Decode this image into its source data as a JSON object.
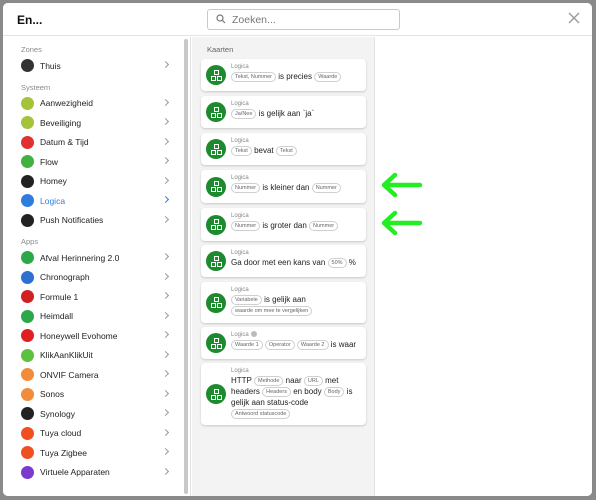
{
  "window": {
    "title": "En..."
  },
  "search": {
    "placeholder": "Zoeken..."
  },
  "sidebar": {
    "sections": [
      {
        "title": "Zones",
        "items": [
          {
            "label": "Thuis",
            "icon": "home-icon",
            "color": "#333333"
          }
        ]
      },
      {
        "title": "Systeem",
        "items": [
          {
            "label": "Aanwezigheid",
            "icon": "presence-icon",
            "color": "#a4c23a"
          },
          {
            "label": "Beveiliging",
            "icon": "security-icon",
            "color": "#a4c23a"
          },
          {
            "label": "Datum & Tijd",
            "icon": "calendar-icon",
            "color": "#e03030"
          },
          {
            "label": "Flow",
            "icon": "flow-icon",
            "color": "#40b040"
          },
          {
            "label": "Homey",
            "icon": "homey-icon",
            "color": "#222222"
          },
          {
            "label": "Logica",
            "icon": "logic-icon",
            "color": "#2f7ce0"
          },
          {
            "label": "Push Notificaties",
            "icon": "phone-icon",
            "color": "#222222"
          }
        ]
      },
      {
        "title": "Apps",
        "items": [
          {
            "label": "Afval Herinnering 2.0",
            "icon": "trash-icon",
            "color": "#2aa84a"
          },
          {
            "label": "Chronograph",
            "icon": "stopwatch-icon",
            "color": "#2f6fcf"
          },
          {
            "label": "Formule 1",
            "icon": "f1-icon",
            "color": "#d02020"
          },
          {
            "label": "Heimdall",
            "icon": "shield-icon",
            "color": "#2aa84a"
          },
          {
            "label": "Honeywell Evohome",
            "icon": "honeywell-icon",
            "color": "#e02020"
          },
          {
            "label": "KlikAanKlikUit",
            "icon": "kaku-icon",
            "color": "#5cc040"
          },
          {
            "label": "ONVIF Camera",
            "icon": "camera-icon",
            "color": "#f08c3a"
          },
          {
            "label": "Sonos",
            "icon": "sonos-icon",
            "color": "#f08c3a"
          },
          {
            "label": "Synology",
            "icon": "synology-icon",
            "color": "#222222"
          },
          {
            "label": "Tuya cloud",
            "icon": "tuya-icon",
            "color": "#f05020"
          },
          {
            "label": "Tuya Zigbee",
            "icon": "tuya-zigbee-icon",
            "color": "#f05020"
          },
          {
            "label": "Virtuele Apparaten",
            "icon": "virtual-devices-icon",
            "color": "#7a3ad0"
          }
        ]
      }
    ]
  },
  "cards_panel": {
    "title": "Kaarten",
    "cards": [
      {
        "type": "Logica",
        "parts": [
          {
            "chip": "Tekst, Nummer"
          },
          {
            "text": "is precies"
          },
          {
            "chip": "Waarde"
          }
        ]
      },
      {
        "type": "Logica",
        "parts": [
          {
            "chip": "Ja/Nee"
          },
          {
            "text": "is gelijk aan `ja`"
          }
        ]
      },
      {
        "type": "Logica",
        "parts": [
          {
            "chip": "Tekst"
          },
          {
            "text": "bevat"
          },
          {
            "chip": "Tekst"
          }
        ]
      },
      {
        "type": "Logica",
        "parts": [
          {
            "chip": "Nummer"
          },
          {
            "text": "is kleiner dan"
          },
          {
            "chip": "Nummer"
          }
        ]
      },
      {
        "type": "Logica",
        "parts": [
          {
            "chip": "Nummer"
          },
          {
            "text": "is groter dan"
          },
          {
            "chip": "Nummer"
          }
        ]
      },
      {
        "type": "Logica",
        "parts": [
          {
            "text": "Ga door met een kans van"
          },
          {
            "chip": "50%"
          },
          {
            "text": "%"
          }
        ]
      },
      {
        "type": "Logica",
        "parts": [
          {
            "chip": "Variabele"
          },
          {
            "text": "is gelijk aan"
          },
          {
            "chip": "waarde om mee te vergelijken"
          }
        ]
      },
      {
        "type": "Logica",
        "info": true,
        "parts": [
          {
            "chip": "Waarde 1"
          },
          {
            "chip": "Operator"
          },
          {
            "chip": "Waarde 2"
          },
          {
            "text": "is waar"
          }
        ]
      },
      {
        "type": "Logica",
        "parts": [
          {
            "text": "HTTP"
          },
          {
            "chip": "Methode"
          },
          {
            "text": "naar"
          },
          {
            "chip": "URL"
          },
          {
            "text": "met headers"
          },
          {
            "chip": "Headers"
          },
          {
            "text": "en body"
          },
          {
            "chip": "Body"
          },
          {
            "text": "is gelijk aan status-code"
          },
          {
            "chip": "Antwoord statuscode"
          }
        ]
      }
    ]
  },
  "annotations": {
    "arrow_color": "#22ee22"
  },
  "colors": {
    "accent": "#2f7ce0",
    "card_icon": "#1e8a2e"
  }
}
